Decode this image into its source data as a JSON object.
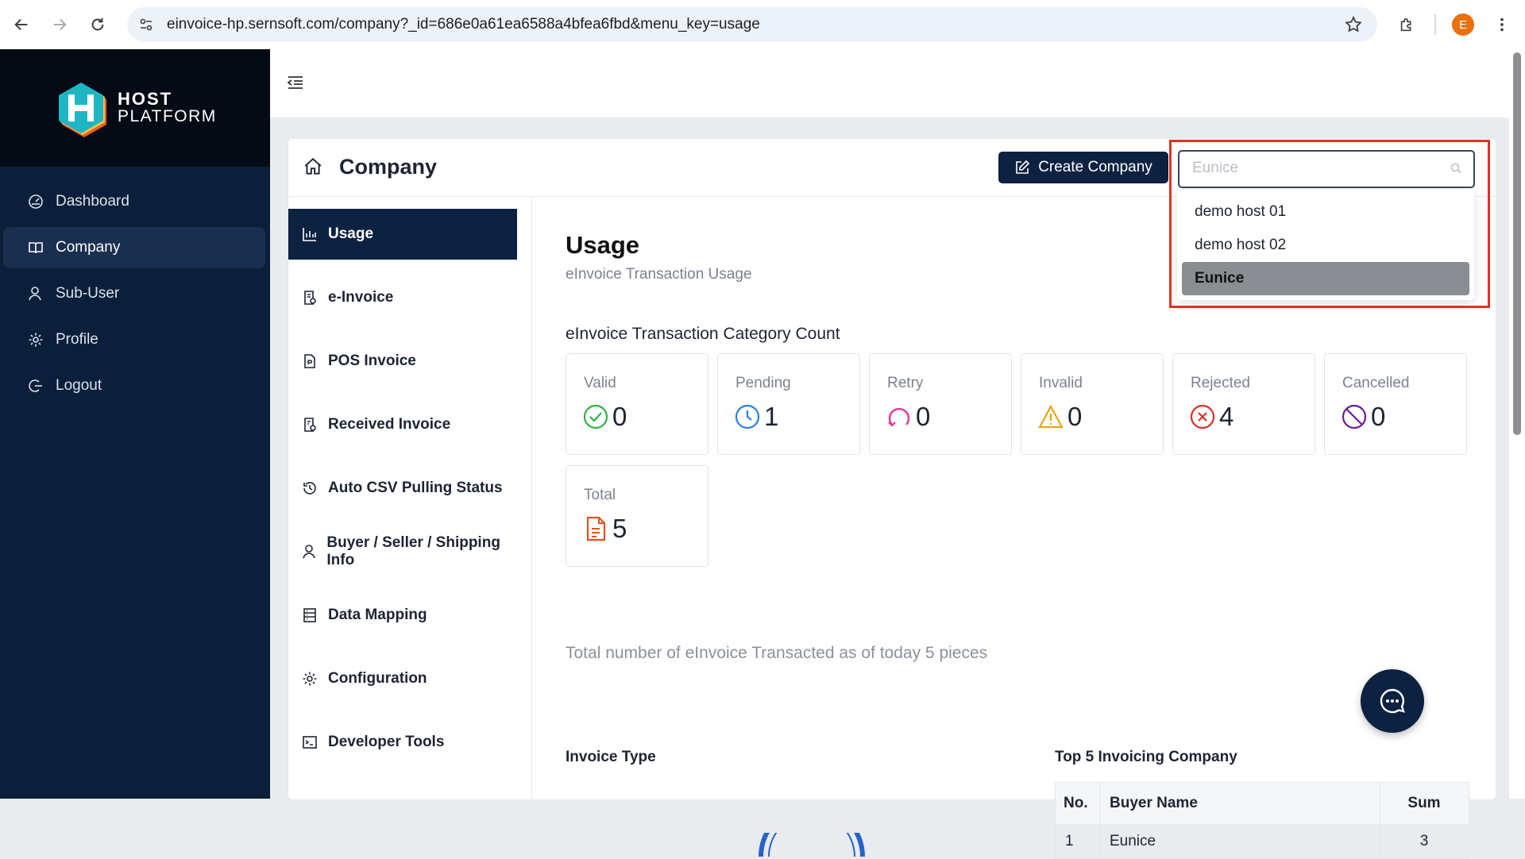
{
  "browser": {
    "url": "einvoice-hp.sernsoft.com/company?_id=686e0a61ea6588a4bfea6fbd&menu_key=usage",
    "profile_initial": "E"
  },
  "logo": {
    "line1": "HOST",
    "line2": "PLATFORM"
  },
  "sidebar": {
    "items": [
      {
        "label": "Dashboard",
        "icon": "dashboard-icon"
      },
      {
        "label": "Company",
        "icon": "book-icon",
        "active": true
      },
      {
        "label": "Sub-User",
        "icon": "user-icon"
      },
      {
        "label": "Profile",
        "icon": "gear-icon"
      },
      {
        "label": "Logout",
        "icon": "logout-icon"
      }
    ]
  },
  "header": {
    "title": "Company",
    "create_button": "Create Company",
    "search": {
      "value": "",
      "placeholder": "Eunice"
    }
  },
  "dropdown": {
    "options": [
      "demo host 01",
      "demo host 02",
      "Eunice"
    ],
    "selected": "Eunice"
  },
  "subnav": {
    "items": [
      {
        "label": "Usage",
        "icon": "bar-chart-icon",
        "active": true
      },
      {
        "label": "e-Invoice",
        "icon": "invoice-icon"
      },
      {
        "label": "POS Invoice",
        "icon": "file-icon"
      },
      {
        "label": "Received Invoice",
        "icon": "received-icon"
      },
      {
        "label": "Auto CSV Pulling Status",
        "icon": "history-icon"
      },
      {
        "label": "Buyer / Seller / Shipping Info",
        "icon": "user-icon"
      },
      {
        "label": "Data Mapping",
        "icon": "database-icon"
      },
      {
        "label": "Configuration",
        "icon": "gear-icon"
      },
      {
        "label": "Developer Tools",
        "icon": "code-icon"
      }
    ]
  },
  "usage": {
    "title": "Usage",
    "subtitle": "eInvoice Transaction Usage",
    "category_title": "eInvoice Transaction Category Count",
    "stats": [
      {
        "label": "Valid",
        "value": "0",
        "icon": "check-circle-icon",
        "color": "#2fb344"
      },
      {
        "label": "Pending",
        "value": "1",
        "icon": "clock-icon",
        "color": "#2f7fe0"
      },
      {
        "label": "Retry",
        "value": "0",
        "icon": "retry-icon",
        "color": "#e8359a"
      },
      {
        "label": "Invalid",
        "value": "0",
        "icon": "warning-icon",
        "color": "#e8a317"
      },
      {
        "label": "Rejected",
        "value": "4",
        "icon": "x-circle-icon",
        "color": "#d93025"
      },
      {
        "label": "Cancelled",
        "value": "0",
        "icon": "ban-icon",
        "color": "#6a1b9a"
      },
      {
        "label": "Total",
        "value": "5",
        "icon": "document-icon",
        "color": "#e0541f"
      }
    ],
    "total_note": "Total number of eInvoice Transacted as of today 5 pieces",
    "invoice_type_title": "Invoice Type",
    "top5_title": "Top 5 Invoicing Company",
    "top5_columns": [
      "No.",
      "Buyer Name",
      "Sum"
    ],
    "top5_rows": [
      {
        "no": "1",
        "name": "Eunice",
        "sum": "3"
      }
    ]
  },
  "colors": {
    "sidebar_bg": "#0b1f3a",
    "accent": "#0d2141",
    "highlight": "#e0321f"
  }
}
